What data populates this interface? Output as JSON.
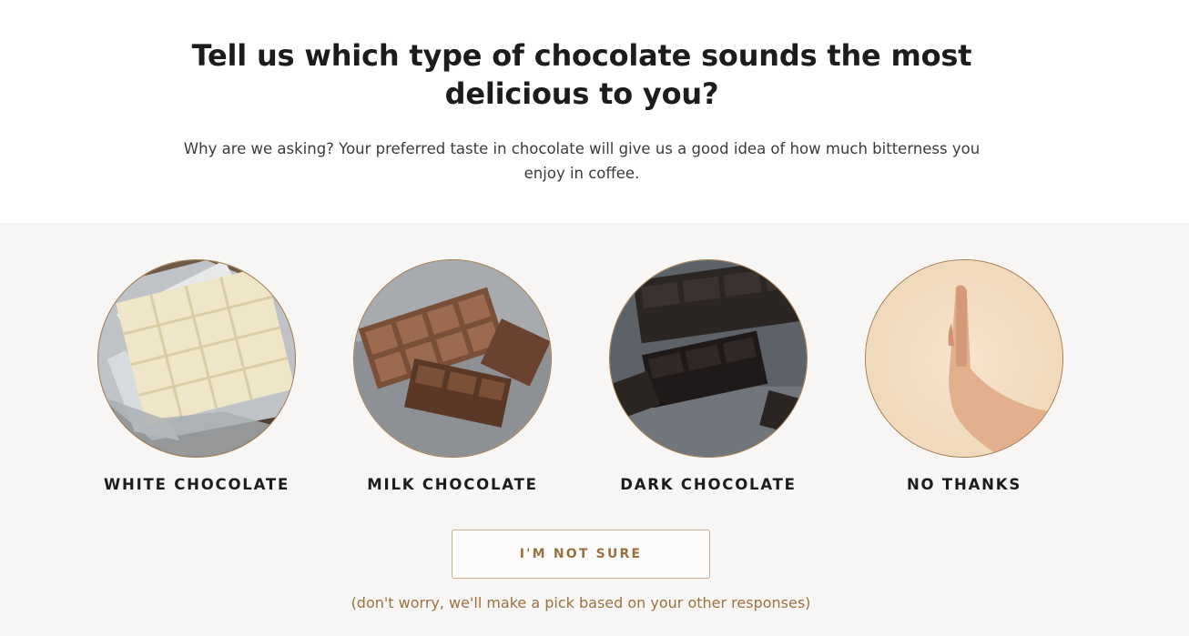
{
  "header": {
    "question": "Tell us which type of chocolate sounds the most delicious to you?",
    "subtitle": "Why are we asking? Your preferred taste in chocolate will give us a good idea of how much bitterness you enjoy in coffee."
  },
  "options": [
    {
      "label": "WHITE CHOCOLATE",
      "image": "white-chocolate-bar-in-foil"
    },
    {
      "label": "MILK CHOCOLATE",
      "image": "milk-chocolate-pieces"
    },
    {
      "label": "DARK CHOCOLATE",
      "image": "dark-chocolate-pieces"
    },
    {
      "label": "NO THANKS",
      "image": "hand-stop-gesture"
    }
  ],
  "unsure": {
    "label": "I'M NOT SURE",
    "note": "(don't worry, we'll make a pick based on your other responses)"
  },
  "colors": {
    "accent": "#9a7241",
    "border": "#a37a4b",
    "panel_bg": "#f8f6f4"
  }
}
